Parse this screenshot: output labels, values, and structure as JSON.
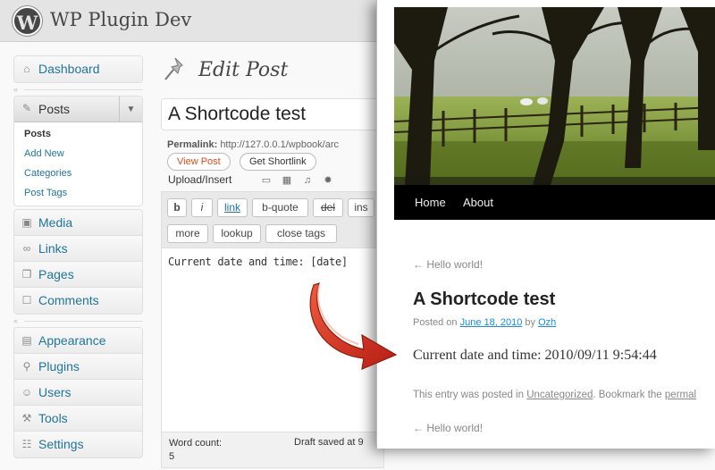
{
  "admin": {
    "site_name": "WP Plugin Dev",
    "logo_glyph": "W",
    "menu_top": [
      {
        "label": "Dashboard",
        "icon": "dashboard-icon"
      }
    ],
    "posts_menu": {
      "label": "Posts",
      "icon": "pushpin-icon",
      "submenu": [
        {
          "label": "Posts",
          "current": true
        },
        {
          "label": "Add New"
        },
        {
          "label": "Categories"
        },
        {
          "label": "Post Tags"
        }
      ]
    },
    "menu_mid": [
      {
        "label": "Media",
        "icon": "media-icon"
      },
      {
        "label": "Links",
        "icon": "links-icon"
      },
      {
        "label": "Pages",
        "icon": "pages-icon"
      },
      {
        "label": "Comments",
        "icon": "comments-icon"
      }
    ],
    "menu_bottom": [
      {
        "label": "Appearance",
        "icon": "appearance-icon"
      },
      {
        "label": "Plugins",
        "icon": "plugins-icon"
      },
      {
        "label": "Users",
        "icon": "users-icon"
      },
      {
        "label": "Tools",
        "icon": "tools-icon"
      },
      {
        "label": "Settings",
        "icon": "settings-icon"
      }
    ],
    "page_title": "Edit Post",
    "post_title_value": "A Shortcode test",
    "permalink_label": "Permalink:",
    "permalink_url": "http://127.0.0.1/wpbook/arc",
    "view_post_label": "View Post",
    "get_shortlink_label": "Get Shortlink",
    "upload_insert_label": "Upload/Insert",
    "quicktags_row1": [
      "b",
      "i",
      "link",
      "b-quote",
      "del",
      "ins"
    ],
    "quicktags_row2": [
      "more",
      "lookup",
      "close tags"
    ],
    "editor_content": "Current date and time: [date]",
    "word_count_label": "Word count: 5",
    "draft_saved_label": "Draft saved at 9"
  },
  "front": {
    "nav": [
      "Home",
      "About"
    ],
    "prev_link": "← Hello world!",
    "post_title": "A Shortcode test",
    "meta_prefix": "Posted on ",
    "meta_date": "June 18, 2010",
    "meta_by": " by ",
    "meta_author": "Ozh",
    "content": "Current date and time: 2010/09/11 9:54:44",
    "footer_prefix": "This entry was posted in ",
    "footer_category": "Uncategorized",
    "footer_mid": ". Bookmark the ",
    "footer_permalink": "permal"
  },
  "colors": {
    "link_blue": "#21759b",
    "view_post_orange": "#d54e21",
    "nav_black": "#000000",
    "arrow_red": "#d32a1d"
  }
}
